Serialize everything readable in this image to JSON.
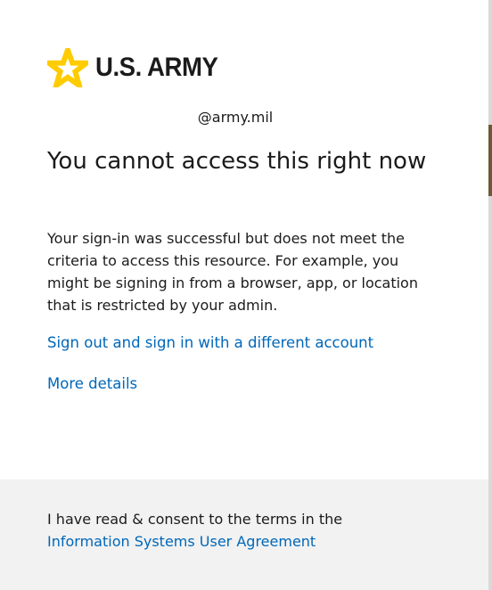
{
  "brand": {
    "name": "U.S. ARMY",
    "logo_icon": "star-icon",
    "star_color": "#ffcc01"
  },
  "identity": "@army.mil",
  "page": {
    "title": "You cannot access this right now",
    "description": "Your sign-in was successful but does not meet the criteria to access this resource. For example, you might be signing in from a browser, app, or location that is restricted by your admin."
  },
  "links": {
    "sign_out": "Sign out and sign in with a different account",
    "more_details": "More details"
  },
  "footer": {
    "consent_text": "I have read & consent to the terms in the",
    "agreement_link": "Information Systems User Agreement"
  },
  "colors": {
    "link": "#0067b8",
    "text": "#1b1b1b",
    "footer_bg": "#f2f2f2"
  }
}
